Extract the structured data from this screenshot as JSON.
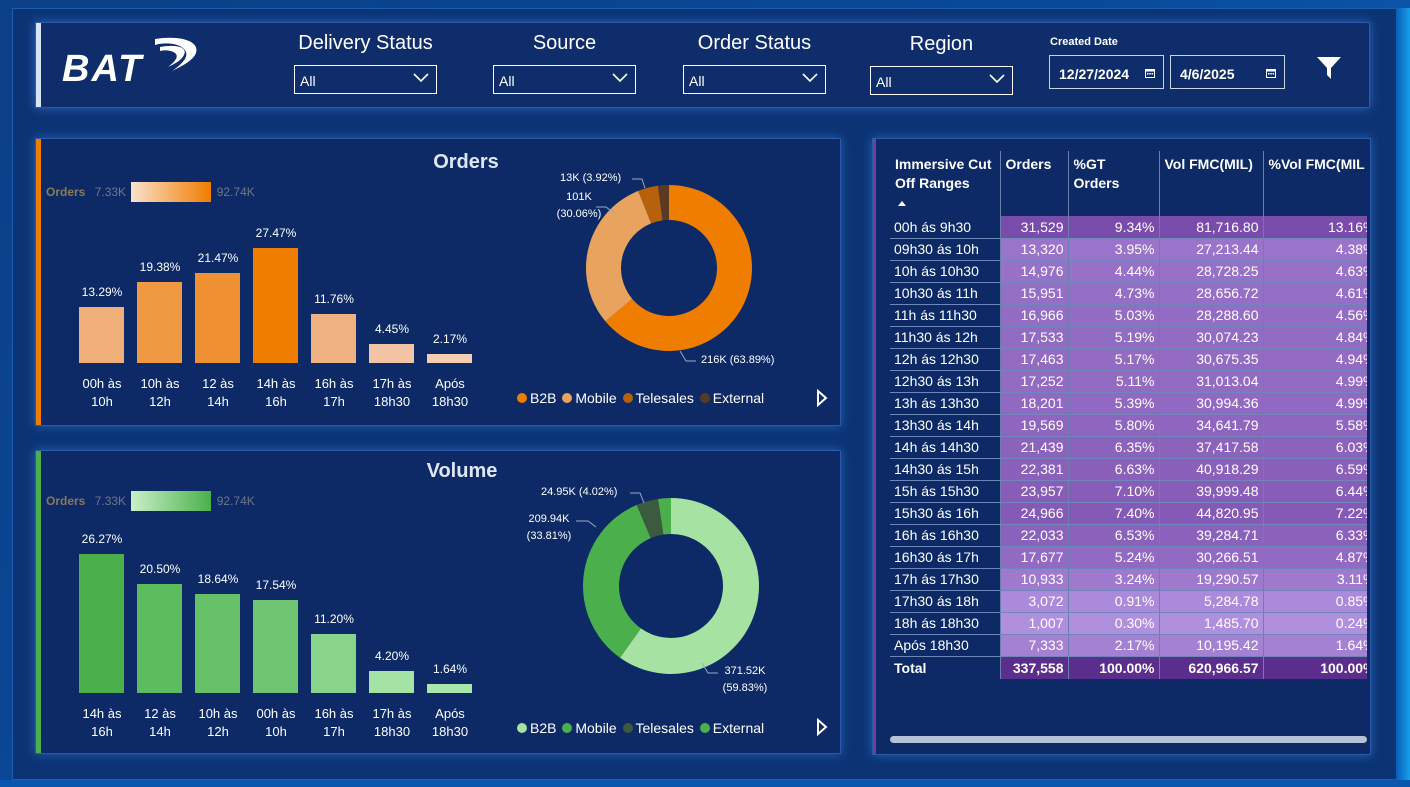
{
  "brand": {
    "logo_text": "BAT"
  },
  "filters": [
    {
      "label": "Delivery Status",
      "value": "All"
    },
    {
      "label": "Source",
      "value": "All"
    },
    {
      "label": "Order Status",
      "value": "All"
    },
    {
      "label": "Region",
      "value": "All"
    }
  ],
  "date_filter": {
    "label": "Created Date",
    "start": "12/27/2024",
    "end": "4/6/2025"
  },
  "orders_panel": {
    "title": "Orders",
    "slicer": {
      "label": "Orders",
      "min": "7.33K",
      "max": "92.74K"
    },
    "legend": [
      {
        "name": "B2B",
        "color": "#ef7d00"
      },
      {
        "name": "Mobile",
        "color": "#e8a35e"
      },
      {
        "name": "Telesales",
        "color": "#b8610d"
      },
      {
        "name": "External",
        "color": "#5a3a22"
      }
    ]
  },
  "volume_panel": {
    "title": "Volume",
    "slicer": {
      "label": "Orders",
      "min": "7.33K",
      "max": "92.74K"
    },
    "legend": [
      {
        "name": "B2B",
        "color": "#a6e3a2"
      },
      {
        "name": "Mobile",
        "color": "#4bb04c"
      },
      {
        "name": "Telesales",
        "color": "#3b5a3e"
      },
      {
        "name": "External",
        "color": "#4bb04c"
      }
    ]
  },
  "chart_data": [
    {
      "type": "bar",
      "categories": [
        [
          "00h às",
          "10h"
        ],
        [
          "10h às",
          "12h"
        ],
        [
          "12 às",
          "14h"
        ],
        [
          "14h às",
          "16h"
        ],
        [
          "16h às",
          "17h"
        ],
        [
          "17h às",
          "18h30"
        ],
        [
          "Após",
          "18h30"
        ]
      ],
      "values": [
        13.29,
        19.38,
        21.47,
        27.47,
        11.76,
        4.45,
        2.17
      ],
      "labels": [
        "13.29%",
        "19.38%",
        "21.47%",
        "27.47%",
        "11.76%",
        "4.45%",
        "2.17%"
      ],
      "colors": [
        "#f0ae7a",
        "#ef9a42",
        "#ef9033",
        "#ef7d00",
        "#f1b283",
        "#f3c4a3",
        "#f5cdb3"
      ]
    },
    {
      "type": "pie",
      "slices": [
        {
          "name": "B2B",
          "value": 63.89,
          "label": "216K (63.89%)",
          "color": "#ef7d00"
        },
        {
          "name": "Mobile",
          "value": 30.06,
          "label_lines": [
            "101K",
            "(30.06%)"
          ],
          "color": "#e8a35e"
        },
        {
          "name": "Telesales",
          "value": 3.92,
          "label": "13K (3.92%)",
          "color": "#b8610d"
        },
        {
          "name": "External",
          "value": 2.13,
          "color": "#5a3a22"
        }
      ]
    },
    {
      "type": "bar",
      "categories": [
        [
          "14h às",
          "16h"
        ],
        [
          "12 às",
          "14h"
        ],
        [
          "10h às",
          "12h"
        ],
        [
          "00h às",
          "10h"
        ],
        [
          "16h às",
          "17h"
        ],
        [
          "17h às",
          "18h30"
        ],
        [
          "Após",
          "18h30"
        ]
      ],
      "values": [
        26.27,
        20.5,
        18.64,
        17.54,
        11.2,
        4.2,
        1.64
      ],
      "labels": [
        "26.27%",
        "20.50%",
        "18.64%",
        "17.54%",
        "11.20%",
        "4.20%",
        "1.64%"
      ],
      "colors": [
        "#4bb04c",
        "#5cbc5e",
        "#66c067",
        "#70c572",
        "#88d48a",
        "#a4e3a4",
        "#a9e6aa"
      ]
    },
    {
      "type": "pie",
      "slices": [
        {
          "name": "B2B",
          "value": 59.83,
          "label_lines": [
            "371.52K",
            "(59.83%)"
          ],
          "color": "#a6e3a2"
        },
        {
          "name": "Mobile",
          "value": 33.81,
          "label_lines": [
            "209.94K",
            "(33.81%)"
          ],
          "color": "#4bb04c"
        },
        {
          "name": "Telesales",
          "value": 4.02,
          "label": "24.95K (4.02%)",
          "color": "#3b5a3e"
        },
        {
          "name": "External",
          "value": 2.34,
          "color": "#4bb04c"
        }
      ]
    },
    {
      "type": "table",
      "columns": [
        "Immersive Cut Off Ranges",
        "Orders",
        "%GT Orders",
        "Vol FMC(MIL)",
        "%Vol FMC(MIL"
      ],
      "rows": [
        [
          "00h ás 9h30",
          "31,529",
          "9.34%",
          "81,716.80",
          "13.16%"
        ],
        [
          "09h30 ás 10h",
          "13,320",
          "3.95%",
          "27,213.44",
          "4.38%"
        ],
        [
          "10h ás 10h30",
          "14,976",
          "4.44%",
          "28,728.25",
          "4.63%"
        ],
        [
          "10h30 ás 11h",
          "15,951",
          "4.73%",
          "28,656.72",
          "4.61%"
        ],
        [
          "11h ás 11h30",
          "16,966",
          "5.03%",
          "28,288.60",
          "4.56%"
        ],
        [
          "11h30 ás 12h",
          "17,533",
          "5.19%",
          "30,074.23",
          "4.84%"
        ],
        [
          "12h ás 12h30",
          "17,463",
          "5.17%",
          "30,675.35",
          "4.94%"
        ],
        [
          "12h30 ás 13h",
          "17,252",
          "5.11%",
          "31,013.04",
          "4.99%"
        ],
        [
          "13h ás 13h30",
          "18,201",
          "5.39%",
          "30,994.36",
          "4.99%"
        ],
        [
          "13h30 ás 14h",
          "19,569",
          "5.80%",
          "34,641.79",
          "5.58%"
        ],
        [
          "14h ás 14h30",
          "21,439",
          "6.35%",
          "37,417.58",
          "6.03%"
        ],
        [
          "14h30 ás 15h",
          "22,381",
          "6.63%",
          "40,918.29",
          "6.59%"
        ],
        [
          "15h ás 15h30",
          "23,957",
          "7.10%",
          "39,999.48",
          "6.44%"
        ],
        [
          "15h30 ás 16h",
          "24,966",
          "7.40%",
          "44,820.95",
          "7.22%"
        ],
        [
          "16h ás 16h30",
          "22,033",
          "6.53%",
          "39,284.71",
          "6.33%"
        ],
        [
          "16h30 ás 17h",
          "17,677",
          "5.24%",
          "30,266.51",
          "4.87%"
        ],
        [
          "17h ás 17h30",
          "10,933",
          "3.24%",
          "19,290.57",
          "3.11%"
        ],
        [
          "17h30 ás 18h",
          "3,072",
          "0.91%",
          "5,284.78",
          "0.85%"
        ],
        [
          "18h ás 18h30",
          "1,007",
          "0.30%",
          "1,485.70",
          "0.24%"
        ],
        [
          "Após 18h30",
          "7,333",
          "2.17%",
          "10,195.42",
          "1.64%"
        ]
      ],
      "total": [
        "Total",
        "337,558",
        "100.00%",
        "620,966.57",
        "100.00%"
      ]
    }
  ]
}
